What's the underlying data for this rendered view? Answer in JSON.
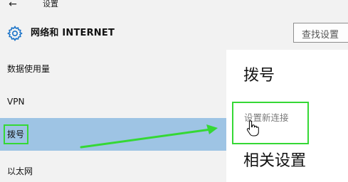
{
  "window": {
    "back_glyph": "←",
    "title": "设置"
  },
  "header": {
    "icon": "gear-icon",
    "title": "网络和 INTERNET"
  },
  "search": {
    "placeholder": "查找设置"
  },
  "sidebar": {
    "items": [
      {
        "label": "数据使用量",
        "selected": false
      },
      {
        "label": "VPN",
        "selected": false
      },
      {
        "label": "拨号",
        "selected": true
      },
      {
        "label": "以太网",
        "selected": false
      }
    ]
  },
  "content": {
    "heading": "拨号",
    "setup_link": "设置新连接",
    "related_heading": "相关设置"
  },
  "colors": {
    "selected_bg": "#9ec4e4",
    "annotation": "#35d835",
    "accent_gear": "#1a73c8"
  }
}
